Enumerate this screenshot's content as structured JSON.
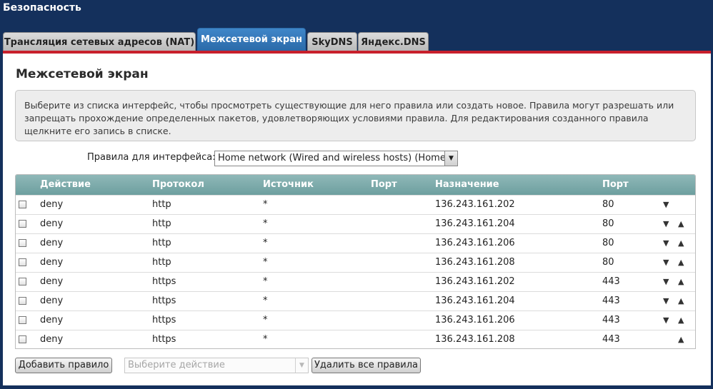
{
  "app": {
    "title": "Безопасность"
  },
  "tabs": [
    {
      "label": "Трансляция сетевых адресов (NAT)"
    },
    {
      "label": "Межсетевой экран"
    },
    {
      "label": "SkyDNS"
    },
    {
      "label": "Яндекс.DNS"
    }
  ],
  "panel": {
    "title": "Межсетевой экран",
    "info": "Выберите из списка интерфейс, чтобы просмотреть существующие для него правила или создать новое. Правила могут разрешать или запрещать прохождение определенных пакетов, удовлетворяющих условиями правила. Для редактирования созданного правила щелкните его запись в списке."
  },
  "interface": {
    "label": "Правила для интерфейса:",
    "selected": "Home network (Wired and wireless hosts) (Home)",
    "arrow": "▼"
  },
  "table": {
    "columns": {
      "action": "Действие",
      "protocol": "Протокол",
      "source": "Источник",
      "source_port": "Порт",
      "destination": "Назначение",
      "dest_port": "Порт"
    },
    "rows": [
      {
        "action": "deny",
        "protocol": "http",
        "source": "*",
        "destination": "136.243.161.202",
        "port": "80",
        "down": "▼",
        "up": ""
      },
      {
        "action": "deny",
        "protocol": "http",
        "source": "*",
        "destination": "136.243.161.204",
        "port": "80",
        "down": "▼",
        "up": "▲"
      },
      {
        "action": "deny",
        "protocol": "http",
        "source": "*",
        "destination": "136.243.161.206",
        "port": "80",
        "down": "▼",
        "up": "▲"
      },
      {
        "action": "deny",
        "protocol": "http",
        "source": "*",
        "destination": "136.243.161.208",
        "port": "80",
        "down": "▼",
        "up": "▲"
      },
      {
        "action": "deny",
        "protocol": "https",
        "source": "*",
        "destination": "136.243.161.202",
        "port": "443",
        "down": "▼",
        "up": "▲"
      },
      {
        "action": "deny",
        "protocol": "https",
        "source": "*",
        "destination": "136.243.161.204",
        "port": "443",
        "down": "▼",
        "up": "▲"
      },
      {
        "action": "deny",
        "protocol": "https",
        "source": "*",
        "destination": "136.243.161.206",
        "port": "443",
        "down": "▼",
        "up": "▲"
      },
      {
        "action": "deny",
        "protocol": "https",
        "source": "*",
        "destination": "136.243.161.208",
        "port": "443",
        "down": "",
        "up": "▲"
      }
    ]
  },
  "footer": {
    "add_rule": "Добавить правило",
    "action_placeholder": "Выберите действие",
    "action_arrow": "▼",
    "delete_all": "Удалить все правила"
  },
  "colors": {
    "background": "#14305c",
    "active_tab": "#2b6aa8",
    "accent_bar": "#c8202c",
    "table_header": "#7aa8a8"
  }
}
